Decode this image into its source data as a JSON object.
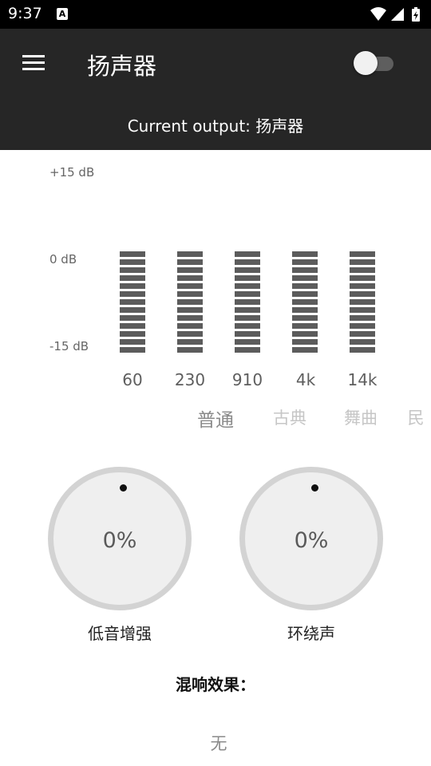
{
  "status_bar": {
    "time": "9:37",
    "notification_icon": "A",
    "icons": [
      "wifi-icon",
      "signal-icon",
      "battery-icon"
    ]
  },
  "app_bar": {
    "title": "扬声器",
    "menu_icon": "menu-icon",
    "toggle_on": false,
    "current_output": "Current output: 扬声器"
  },
  "equalizer": {
    "db_labels": {
      "top": "+15 dB",
      "mid": "0 dB",
      "bottom": "-15 dB"
    },
    "bands": [
      {
        "freq": "60",
        "gain_db": 0
      },
      {
        "freq": "230",
        "gain_db": 0
      },
      {
        "freq": "910",
        "gain_db": 0
      },
      {
        "freq": "4k",
        "gain_db": 0
      },
      {
        "freq": "14k",
        "gain_db": 0
      }
    ],
    "presets": [
      "普通",
      "古典",
      "舞曲",
      "民"
    ],
    "active_preset": "普通"
  },
  "knobs": [
    {
      "value": "0%",
      "label": "低音增强"
    },
    {
      "value": "0%",
      "label": "环绕声"
    }
  ],
  "reverb": {
    "heading": "混响效果：",
    "value": "无"
  },
  "colors": {
    "app_bar_bg": "#262626",
    "status_bar_bg": "#000000",
    "eq_bar": "#5c5c5c",
    "knob_ring": "#d3d3d3"
  }
}
